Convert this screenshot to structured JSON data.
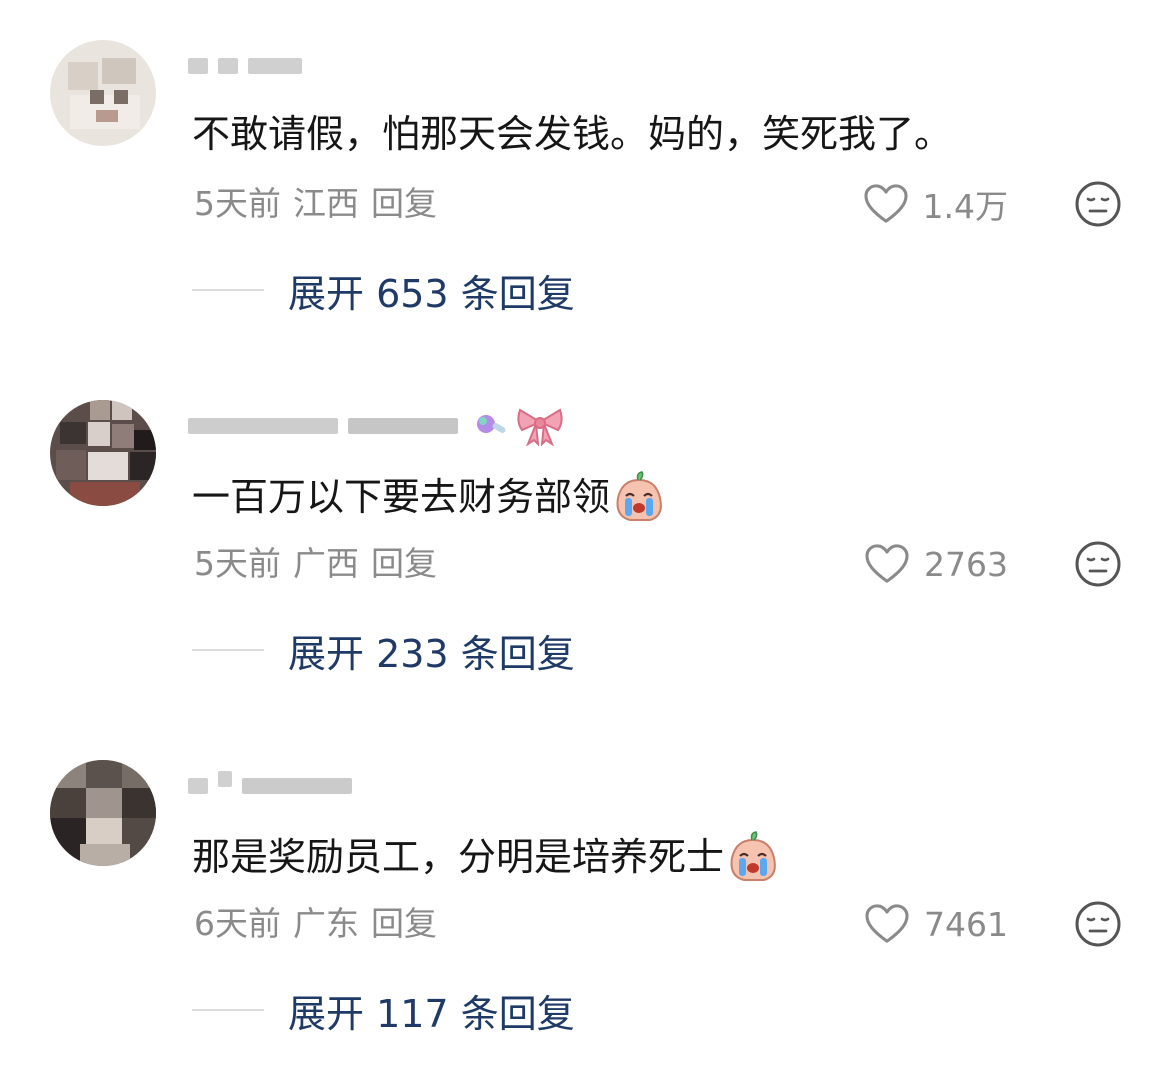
{
  "comments": [
    {
      "text": "不敢请假，怕那天会发钱。妈的，笑死我了。",
      "time": "5天前",
      "location": "江西",
      "reply_label": "回复",
      "likes": "1.4万",
      "expand_label": "展开 653 条回复"
    },
    {
      "text": "一百万以下要去财务部领",
      "time": "5天前",
      "location": "广西",
      "reply_label": "回复",
      "likes": "2763",
      "expand_label": "展开 233 条回复"
    },
    {
      "text": "那是奖励员工，分明是培养死士",
      "time": "6天前",
      "location": "广东",
      "reply_label": "回复",
      "likes": "7461",
      "expand_label": "展开 117 条回复"
    }
  ],
  "icons": {
    "like": "heart-outline-icon",
    "reaction": "meh-face-icon",
    "emoji": "crying-emoji-icon"
  },
  "colors": {
    "text": "#161616",
    "meta": "#8a8a8a",
    "expand": "#1f3a66"
  }
}
